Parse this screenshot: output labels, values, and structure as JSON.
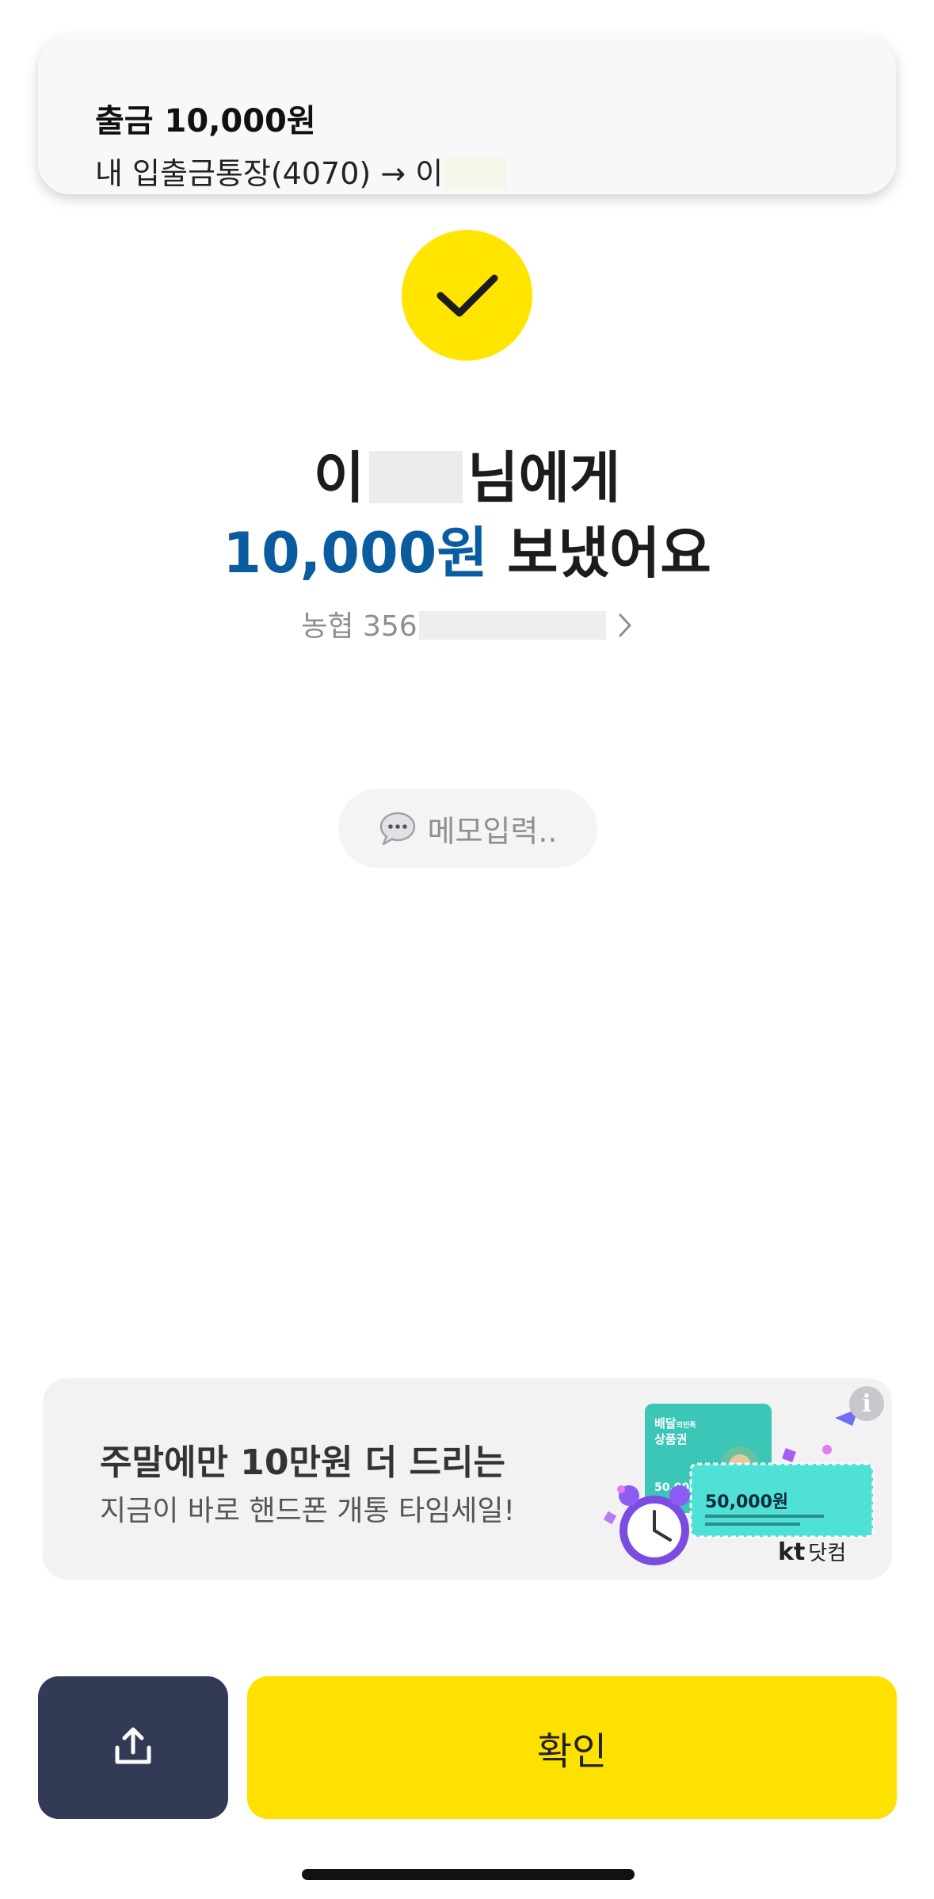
{
  "notification": {
    "title": "출금 10,000원",
    "body": "내 입출금통장(4070) → 이"
  },
  "result": {
    "recipient_prefix": "이",
    "recipient_suffix": "님에게",
    "amount": "10,000원",
    "sent_text": "보냈어요",
    "account_prefix": "농협 356"
  },
  "memo": {
    "placeholder": "메모입력.."
  },
  "ad": {
    "title": "주말에만 10만원 더 드리는",
    "subtitle": "지금이 바로 핸드폰 개통 타임세일!",
    "info_label": "i",
    "card1_title_a": "배달",
    "card1_title_b": "의민족",
    "card1_title_c": "상품권",
    "card1_value": "50,000",
    "card2_value": "50,000원",
    "brand_kt": "kt",
    "brand_name": "닷컴"
  },
  "buttons": {
    "confirm": "확인"
  },
  "colors": {
    "accent_yellow": "#ffe500",
    "amount_blue": "#0a5ca0",
    "share_button_bg": "#323a56"
  }
}
